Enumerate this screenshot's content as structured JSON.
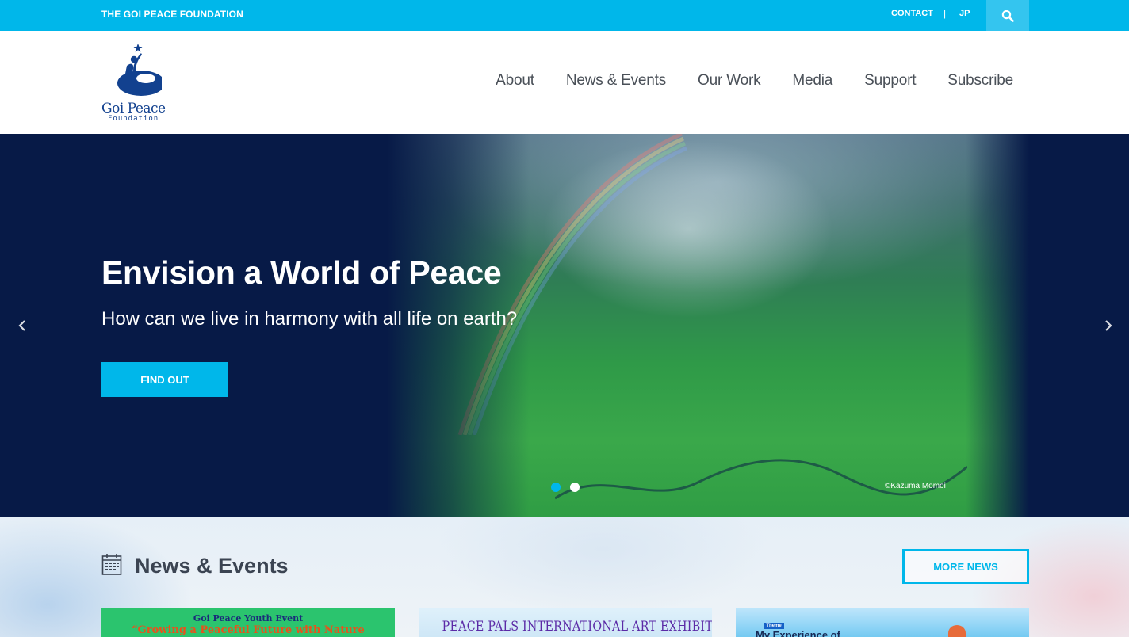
{
  "topbar": {
    "brand": "THE GOI PEACE FOUNDATION",
    "contact": "CONTACT",
    "separator": "|",
    "language": "JP",
    "search_icon": "search-icon"
  },
  "logo": {
    "name": "Goi Peace",
    "sub": "Foundation",
    "icon": "figure-star-icon"
  },
  "nav": {
    "items": [
      {
        "label": "About"
      },
      {
        "label": "News & Events"
      },
      {
        "label": "Our Work"
      },
      {
        "label": "Media"
      },
      {
        "label": "Support"
      },
      {
        "label": "Subscribe"
      }
    ]
  },
  "hero": {
    "title": "Envision a World of Peace",
    "subtitle": "How can we live in harmony with all life on earth?",
    "cta": "FIND OUT",
    "credit": "©Kazuma Momoi",
    "prev_icon": "chevron-left-icon",
    "next_icon": "chevron-right-icon",
    "slides": 2,
    "active_slide": 1
  },
  "news": {
    "title": "News & Events",
    "icon": "calendar-icon",
    "more_button": "MORE NEWS",
    "cards": [
      {
        "line1": "Goi Peace Youth Event",
        "line2": "“Growing a Peaceful Future with Nature"
      },
      {
        "line1": "PEACE PALS INTERNATIONAL ART EXHIBITION & AWARDS"
      },
      {
        "badge": "Theme",
        "line1": "My Experience of"
      }
    ]
  },
  "colors": {
    "accent": "#00b7ea",
    "hero_bg": "#071a47",
    "logo_blue": "#12418f",
    "nav_text": "#4a5058"
  }
}
